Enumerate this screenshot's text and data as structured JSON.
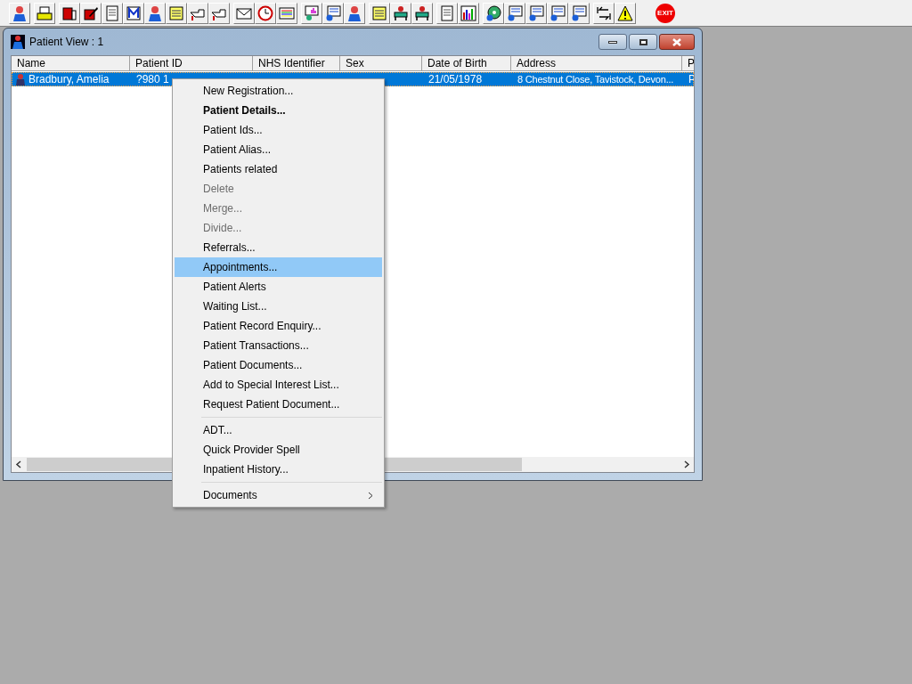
{
  "toolbar": {
    "exit_label": "EXIT"
  },
  "window": {
    "title": "Patient View : 1",
    "columns": [
      "Name",
      "Patient ID",
      "NHS Identifier",
      "Sex",
      "Date of Birth",
      "Address",
      "P"
    ],
    "rows": [
      {
        "selected": true,
        "name": "Bradbury, Amelia",
        "patient_id": "?980 1",
        "date_of_birth": "21/05/1978",
        "address": "8 Chestnut Close, Tavistock, Devon...",
        "column_7": "P"
      }
    ]
  },
  "context_menu": [
    {
      "kind": "item",
      "label": "New Registration...",
      "bold": false,
      "disabled": false,
      "selected": false,
      "submenu": false
    },
    {
      "kind": "item",
      "label": "Patient Details...",
      "bold": true,
      "disabled": false,
      "selected": false,
      "submenu": false
    },
    {
      "kind": "item",
      "label": "Patient Ids...",
      "bold": false,
      "disabled": false,
      "selected": false,
      "submenu": false
    },
    {
      "kind": "item",
      "label": "Patient Alias...",
      "bold": false,
      "disabled": false,
      "selected": false,
      "submenu": false
    },
    {
      "kind": "item",
      "label": "Patients related",
      "bold": false,
      "disabled": false,
      "selected": false,
      "submenu": false
    },
    {
      "kind": "item",
      "label": "Delete",
      "bold": false,
      "disabled": true,
      "selected": false,
      "submenu": false
    },
    {
      "kind": "item",
      "label": "Merge...",
      "bold": false,
      "disabled": true,
      "selected": false,
      "submenu": false
    },
    {
      "kind": "item",
      "label": "Divide...",
      "bold": false,
      "disabled": true,
      "selected": false,
      "submenu": false
    },
    {
      "kind": "item",
      "label": "Referrals...",
      "bold": false,
      "disabled": false,
      "selected": false,
      "submenu": false
    },
    {
      "kind": "item",
      "label": "Appointments...",
      "bold": false,
      "disabled": false,
      "selected": true,
      "submenu": false
    },
    {
      "kind": "item",
      "label": "Patient Alerts",
      "bold": false,
      "disabled": false,
      "selected": false,
      "submenu": false
    },
    {
      "kind": "item",
      "label": "Waiting List...",
      "bold": false,
      "disabled": false,
      "selected": false,
      "submenu": false
    },
    {
      "kind": "item",
      "label": "Patient Record Enquiry...",
      "bold": false,
      "disabled": false,
      "selected": false,
      "submenu": false
    },
    {
      "kind": "item",
      "label": "Patient Transactions...",
      "bold": false,
      "disabled": false,
      "selected": false,
      "submenu": false
    },
    {
      "kind": "item",
      "label": "Patient Documents...",
      "bold": false,
      "disabled": false,
      "selected": false,
      "submenu": false
    },
    {
      "kind": "item",
      "label": "Add to Special Interest List...",
      "bold": false,
      "disabled": false,
      "selected": false,
      "submenu": false
    },
    {
      "kind": "item",
      "label": "Request Patient Document...",
      "bold": false,
      "disabled": false,
      "selected": false,
      "submenu": false
    },
    {
      "kind": "separator"
    },
    {
      "kind": "item",
      "label": "ADT...",
      "bold": false,
      "disabled": false,
      "selected": false,
      "submenu": false
    },
    {
      "kind": "item",
      "label": "Quick Provider Spell",
      "bold": false,
      "disabled": false,
      "selected": false,
      "submenu": false
    },
    {
      "kind": "item",
      "label": "Inpatient History...",
      "bold": false,
      "disabled": false,
      "selected": false,
      "submenu": false
    },
    {
      "kind": "separator"
    },
    {
      "kind": "item",
      "label": "Documents",
      "bold": false,
      "disabled": false,
      "selected": false,
      "submenu": true
    }
  ]
}
